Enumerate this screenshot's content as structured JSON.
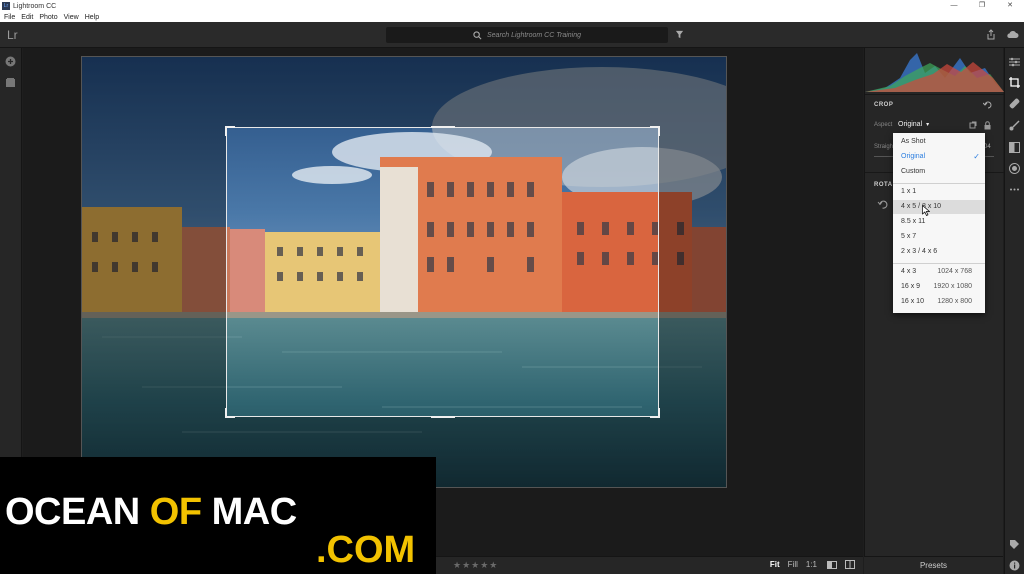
{
  "window": {
    "title": "Lightroom CC",
    "app_icon": "Lr",
    "controls": [
      "—",
      "❐",
      "✕"
    ]
  },
  "menu": [
    "File",
    "Edit",
    "Photo",
    "View",
    "Help"
  ],
  "toolbar": {
    "logo": "Lr",
    "search_placeholder": "Search Lightroom CC Training"
  },
  "crop_panel": {
    "section_title": "CROP",
    "aspect_label": "Aspect",
    "aspect_value": "Original",
    "straighten_label": "Straight",
    "straighten_value": "04",
    "rotate_title": "ROTA"
  },
  "aspect_menu": {
    "items": [
      {
        "label": "As Shot"
      },
      {
        "label": "Original",
        "selected": true
      },
      {
        "label": "Custom"
      },
      {
        "label": "1 x 1"
      },
      {
        "label": "4 x 5 / 8 x 10",
        "hovered": true
      },
      {
        "label": "8.5 x 11"
      },
      {
        "label": "5 x 7"
      },
      {
        "label": "2 x 3 / 4 x 6"
      },
      {
        "label": "4 x 3",
        "resolution": "1024 x 768"
      },
      {
        "label": "16 x 9",
        "resolution": "1920 x 1080"
      },
      {
        "label": "16 x 10",
        "resolution": "1280 x 800"
      }
    ],
    "check": "✓"
  },
  "bottombar": {
    "stars": "★★★★★",
    "zoom": [
      "Fit",
      "Fill",
      "1:1"
    ]
  },
  "presets_label": "Presets",
  "watermark": {
    "ocean": "OCEAN",
    "of": "OF",
    "mac": "MAC",
    "com": ".COM"
  },
  "colors": {
    "accent": "#2d7fe0",
    "watermark_yellow": "#f2c200"
  }
}
